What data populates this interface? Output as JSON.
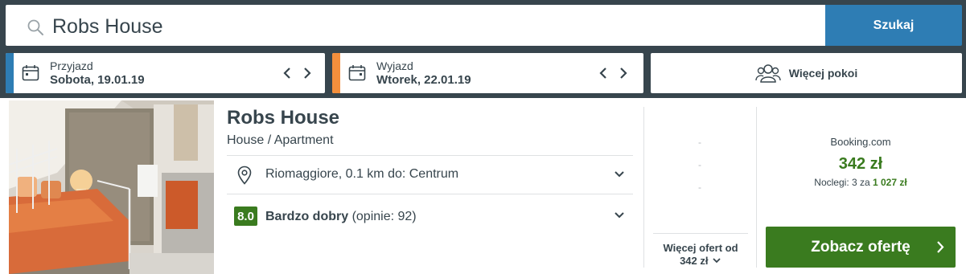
{
  "search": {
    "value": "Robs House",
    "button_label": "Szukaj"
  },
  "dates": {
    "arrival": {
      "label": "Przyjazd",
      "value": "Sobota, 19.01.19"
    },
    "departure": {
      "label": "Wyjazd",
      "value": "Wtorek, 22.01.19"
    }
  },
  "rooms": {
    "label": "Więcej pokoi"
  },
  "hotel": {
    "name": "Robs House",
    "type": "House / Apartment",
    "location": "Riomaggiore, 0.1 km do: Centrum",
    "rating": {
      "score": "8.0",
      "label": "Bardzo dobry",
      "count": "(opinie: 92)"
    }
  },
  "offers": {
    "dashes": [
      "-",
      "-",
      "-"
    ],
    "more_label": "Więcej ofert od",
    "more_price": "342 zł"
  },
  "deal": {
    "provider": "Booking.com",
    "price": "342 zł",
    "nights_prefix": "Noclegi: 3 za ",
    "nights_total": "1 027 zł",
    "button_label": "Zobacz ofertę"
  },
  "colors": {
    "header_bg": "#37454d",
    "search_button": "#2e7db4",
    "arrival_accent": "#2e7db4",
    "departure_accent": "#f48f3c",
    "deal_green": "#3a7b1f"
  },
  "icons": [
    "search-icon",
    "calendar-icon",
    "chevron-left-icon",
    "chevron-right-icon",
    "people-icon",
    "location-pin-icon",
    "chevron-down-icon"
  ]
}
